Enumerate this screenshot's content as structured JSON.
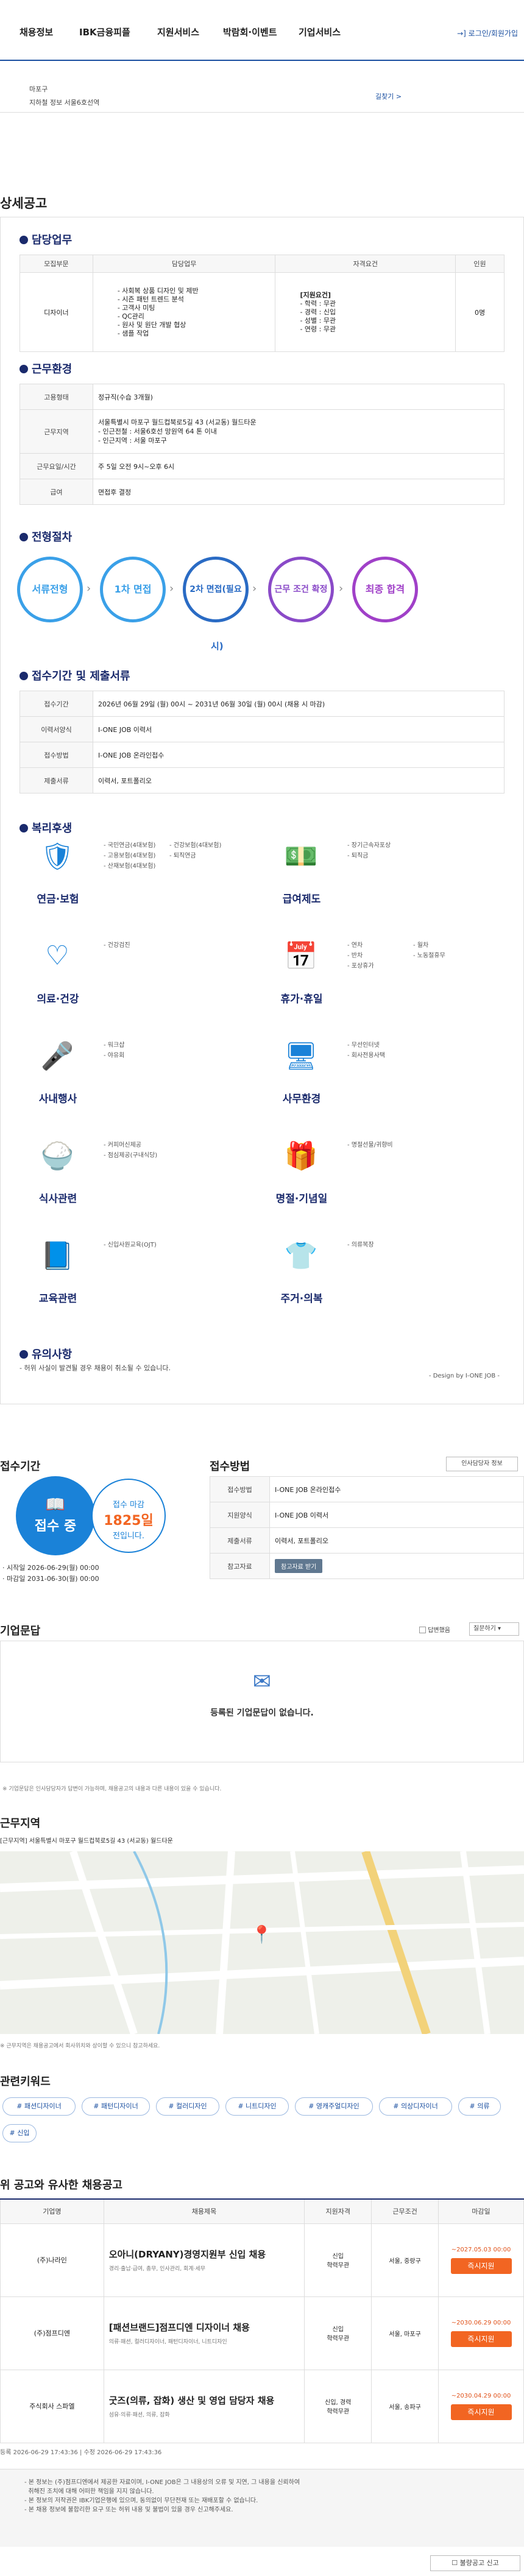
{
  "nav": {
    "items": [
      "채용정보",
      "IBK금융피플",
      "지원서비스",
      "박람회·이벤트",
      "기업서비스"
    ],
    "login": "로그인/회원가입"
  },
  "top_box": {
    "line1": "마포구",
    "line2": "지하철 정보 서울6호선역",
    "link": "길찾기 >"
  },
  "detail": {
    "title": "상세공고",
    "duty": {
      "title": "담당업무",
      "headers": [
        "모집부문",
        "담당업무",
        "자격요건",
        "인원"
      ],
      "row": {
        "part": "디자이너",
        "tasks": [
          "- 사회복 상품 디자인 및 제반",
          "- 시즌 패턴 트렌드 분석",
          "- 고객사 미팅",
          "- QC관리",
          "- 원사 및 원단 개발 협상",
          "- 샘플 작업"
        ],
        "quals": [
          "[지원요건]",
          "- 학력 : 무관",
          "- 경력 : 신입",
          "- 성별 : 무관",
          "- 연령 : 무관"
        ],
        "count": "0명"
      }
    },
    "env": {
      "title": "근무환경",
      "rows": [
        {
          "k": "고용형태",
          "v": "정규직(수습 3개월)"
        },
        {
          "k": "근무지역",
          "v": "서울특별시 마포구 월드컵북로5길 43 (서교동) 월드타운\n- 인근전철 : 서울6호선 망원역 64 톤 이내\n- 인근지역 : 서울 마포구"
        },
        {
          "k": "근무요일/시간",
          "v": "주 5일 오전 9시~오후 6시"
        },
        {
          "k": "급여",
          "v": "면접후 결정"
        }
      ]
    },
    "process": {
      "title": "전형절차",
      "steps": [
        "서류전형",
        "1차 면접",
        "2차 면접(필요",
        "근무 조건 확정",
        "최종 합격"
      ],
      "sub": "시)"
    },
    "period": {
      "title": "접수기간 및 제출서류",
      "rows": [
        {
          "k": "접수기간",
          "v": "2026년 06월 29일 (월) 00시 ~ 2031년 06월 30일 (월) 00시 (채용 시 마감)"
        },
        {
          "k": "이력서양식",
          "v": "I-ONE JOB 이력서"
        },
        {
          "k": "접수방법",
          "v": "I-ONE JOB 온라인접수"
        },
        {
          "k": "제출서류",
          "v": "이력서, 포트폴리오"
        }
      ]
    },
    "benefits": {
      "title": "복리후생",
      "items": [
        {
          "label": "연금·보험",
          "icon": "insurance-icon",
          "list": [
            "- 국민연금(4대보험)",
            "- 고용보험(4대보험)",
            "- 산재보험(4대보험)",
            "- 건강보험(4대보험)",
            "- 퇴직연금"
          ]
        },
        {
          "label": "급여제도",
          "icon": "money-icon",
          "list": [
            "- 장기근속자포상",
            "- 퇴직금"
          ]
        },
        {
          "label": "의료·건강",
          "icon": "heart-pulse-icon",
          "list": [
            "- 건강검진"
          ]
        },
        {
          "label": "휴가·휴일",
          "icon": "calendar-icon",
          "list": [
            "- 연차",
            "- 반차",
            "- 포상휴가",
            "- 월차",
            "- 노동절휴무"
          ]
        },
        {
          "label": "사내행사",
          "icon": "microphone-icon",
          "list": [
            "- 워크샵",
            "- 야유회"
          ]
        },
        {
          "label": "사무환경",
          "icon": "monitor-icon",
          "list": [
            "- 무선인터넷",
            "- 회사전용사택"
          ]
        },
        {
          "label": "식사관련",
          "icon": "rice-bowl-icon",
          "list": [
            "- 커피머신제공",
            "- 점심제공(구내식당)"
          ]
        },
        {
          "label": "명절·기념일",
          "icon": "gift-icon",
          "list": [
            "- 명절선물/귀향비"
          ]
        },
        {
          "label": "교육관련",
          "icon": "book-icon",
          "list": [
            "- 신입사원교육(OJT)"
          ]
        },
        {
          "label": "주거·의복",
          "icon": "shirt-icon",
          "list": [
            "- 의류복장"
          ]
        }
      ]
    },
    "notice": {
      "title": "유의사항",
      "text": "- 허위 사실이 발견될 경우 채용이 취소될 수 있습니다.",
      "design_by": "- Design by I-ONE JOB -"
    }
  },
  "apply": {
    "period_title": "접수기간",
    "method_title": "접수방법",
    "badge": "접수 중",
    "remain_label": "접수 마감",
    "remain_days": "1825일",
    "remain_suffix": "전입니다.",
    "start": "· 시작일 2026-06-29(월) 00:00",
    "end": "· 마감일 2031-06-30(월) 00:00",
    "print_btn": "인사담당자 정보",
    "rows": [
      {
        "k": "접수방법",
        "v": "I-ONE JOB 온라인접수"
      },
      {
        "k": "지원양식",
        "v": "I-ONE JOB 이력서"
      },
      {
        "k": "제출서류",
        "v": "이력서, 포트폴리오"
      },
      {
        "k": "참고자료",
        "v": "참고자료 받기"
      }
    ]
  },
  "qna": {
    "title": "기업문답",
    "checkbox_label": "답변했음",
    "select": "질문하기",
    "empty": "등록된 기업문답이 없습니다.",
    "note": "※ 기업문답은 인사담당자가 답변이 가능하며, 채용공고의 내용과 다른 내용이 있을 수 있습니다."
  },
  "location": {
    "title": "근무지역",
    "address": "[근무지역] 서울특별시 마포구 월드컵북로5길 43 (서교동) 월드타운",
    "map_note": "※ 근무지역은 채용공고에서 회사위치와 상이할 수 있으니 참고하세요."
  },
  "keywords": {
    "title": "관련키워드",
    "tags": [
      "# 패션디자이너",
      "# 패턴디자이너",
      "# 컬러디자인",
      "# 니트디자인",
      "# 영캐주얼디자인",
      "# 의상디자이너",
      "# 의류",
      "# 신입"
    ]
  },
  "similar": {
    "title": "위 공고와 유사한 채용공고",
    "headers": [
      "기업명",
      "채용제목",
      "지원자격",
      "근무조건",
      "마감일"
    ],
    "rows": [
      {
        "company": "(주)나라인",
        "title": "오아니(DRYANY)경영지원부 신입 채용",
        "sub": "경리·출납·급여, 총무, 인사관리, 회계·세무",
        "qual": "신입\n학력무관",
        "cond": "서울, 중랑구",
        "due": "~2027.05.03 00:00"
      },
      {
        "company": "(주)점프디엔",
        "title": "[패션브랜드]점프디엔 디자이너 채용",
        "sub": "의류·패션, 컬러디자이너, 패턴디자이너, 니트디자인",
        "qual": "신입\n학력무관",
        "cond": "서울, 마포구",
        "due": "~2030.06.29 00:00"
      },
      {
        "company": "주식회사 스파엘",
        "title": "굿즈(의류, 잡화) 생산 및 영업 담당자 채용",
        "sub": "섬유·의류·패션, 의류, 잡화",
        "qual": "신입, 경력\n학력무관",
        "cond": "서울, 송파구",
        "due": "~2030.04.29 00:00"
      }
    ],
    "apply_label": "즉시지원",
    "reg": "등록 2026-06-29 17:43:36  |  수정 2026-06-29 17:43:36"
  },
  "footer": {
    "lines": [
      "- 본 정보는 (주)점프디엔에서 제공한 자료이며, I-ONE JOB은 그 내용상의 오류 및 지연, 그 내용을 신뢰하여",
      "  취해진 조치에 대해 어떠한 책임을 지지 않습니다.",
      "- 본 정보의 저작권은 IBK기업은행에 있으며, 동의없이 무단전재 또는 재배포할 수 없습니다.",
      "- 본 채용 정보에 불합리한 요구 또는 허위 내용 및 불법이 있을 경우 신고해주세요."
    ],
    "report": "불량공고 신고"
  }
}
